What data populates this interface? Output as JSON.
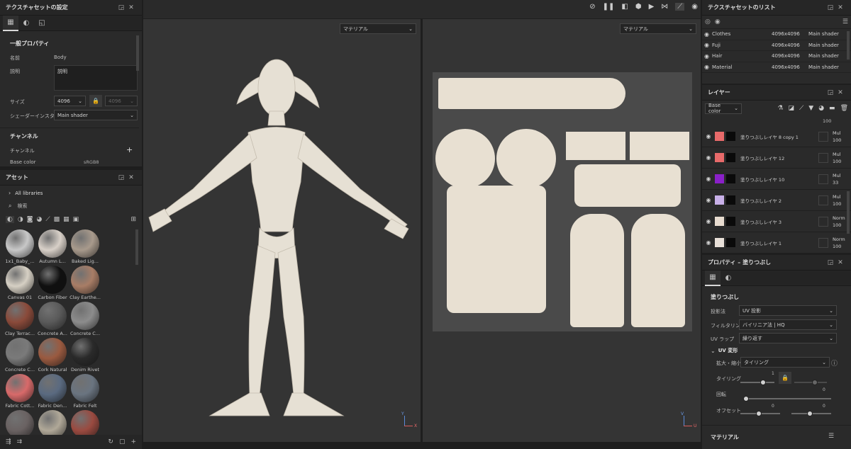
{
  "texset": {
    "title": "テクスチャセットの設定",
    "section_general": "一般プロパティ",
    "name_label": "名前",
    "name_value": "Body",
    "desc_label": "説明",
    "desc_value": "説明",
    "size_label": "サイズ",
    "size_value": "4096",
    "size_value2": "4096",
    "shader_label": "シェーダーインスタンス",
    "shader_value": "Main shader",
    "section_channels": "チャンネル",
    "channels_label": "チャンネル",
    "basecolor_label": "Base color",
    "basecolor_format": "sRGB8"
  },
  "assets": {
    "title": "アセット",
    "libraries": "All libraries",
    "search_placeholder": "検索",
    "items": [
      {
        "name": "1x1_Baby_...",
        "color": "#c8c8c8"
      },
      {
        "name": "Autumn L...",
        "color": "#d8d0c8"
      },
      {
        "name": "Baked Lig...",
        "color": "#a89a8c"
      },
      {
        "name": "Canvas 01",
        "color": "#d6d0c4"
      },
      {
        "name": "Carbon Fiber",
        "color": "#101010"
      },
      {
        "name": "Clay Earthe...",
        "color": "#a87d66"
      },
      {
        "name": "Clay Terrac...",
        "color": "#8a4a3a"
      },
      {
        "name": "Concrete A...",
        "color": "#5a5a5a"
      },
      {
        "name": "Concrete C...",
        "color": "#8c8c8c"
      },
      {
        "name": "Concrete C...",
        "color": "#7a7a7a"
      },
      {
        "name": "Cork Natural",
        "color": "#9a5a40"
      },
      {
        "name": "Denim Rivet",
        "color": "#2a2a2a"
      },
      {
        "name": "Fabric Cott...",
        "color": "#d86a6a"
      },
      {
        "name": "Fabric Den...",
        "color": "#5a6a80"
      },
      {
        "name": "Fabric Felt",
        "color": "#6a7480"
      },
      {
        "name": "",
        "color": "#6a6262"
      },
      {
        "name": "",
        "color": "#b0a898"
      },
      {
        "name": "",
        "color": "#9a4a40"
      }
    ]
  },
  "viewport": {
    "dropdown_left": "マテリアル",
    "dropdown_right": "マテリアル",
    "axis_x": "X",
    "axis_y": "Y",
    "axis_u": "U",
    "axis_v": "V"
  },
  "texlist": {
    "title": "テクスチャセットのリスト",
    "rows": [
      {
        "name": "Clothes",
        "size": "4096x4096",
        "shader": "Main shader"
      },
      {
        "name": "Fuji",
        "size": "4096x4096",
        "shader": "Main shader"
      },
      {
        "name": "Hair",
        "size": "4096x4096",
        "shader": "Main shader"
      },
      {
        "name": "Material",
        "size": "4096x4096",
        "shader": "Main shader"
      }
    ]
  },
  "layers": {
    "title": "レイヤー",
    "channel": "Base color",
    "top_value": "100",
    "rows": [
      {
        "name": "塗りつぶしレイヤ 8 copy 1",
        "color": "#e86a6a",
        "blend": "Mul",
        "opacity": "100"
      },
      {
        "name": "塗りつぶしレイヤ 12",
        "color": "#e86a6a",
        "blend": "Mul",
        "opacity": "100"
      },
      {
        "name": "塗りつぶしレイヤ 10",
        "color": "#8a20c8",
        "blend": "Mul",
        "opacity": "33"
      },
      {
        "name": "塗りつぶしレイヤ 2",
        "color": "#c8b0e8",
        "blend": "Mul",
        "opacity": "100"
      },
      {
        "name": "塗りつぶしレイヤ 3",
        "color": "#e8dcd0",
        "blend": "Norm",
        "opacity": "100"
      },
      {
        "name": "塗りつぶしレイヤ 1",
        "color": "#e8e0d8",
        "blend": "Norm",
        "opacity": "100"
      }
    ]
  },
  "props": {
    "title": "プロパティ – 塗りつぶし",
    "section": "塗りつぶし",
    "projection_label": "投影法",
    "projection_value": "UV 投影",
    "filter_label": "フィルタリング",
    "filter_value": "バイリニア法 | HQ",
    "wrap_label": "UV ラップ",
    "wrap_value": "繰り返す",
    "uv_section": "UV 変形",
    "scale_label": "拡大・縮小",
    "scale_value": "タイリング",
    "tiling_label": "タイリング",
    "tiling_value": "1",
    "rotation_label": "回転",
    "rotation_value": "0",
    "offset_label": "オフセット",
    "offset_x": "0",
    "offset_y": "0",
    "bottom_section": "マテリアル"
  },
  "colors": {
    "panel_bg": "#2a2a2a",
    "viewport_bg": "#343434",
    "skin": "#e8e2d8"
  }
}
